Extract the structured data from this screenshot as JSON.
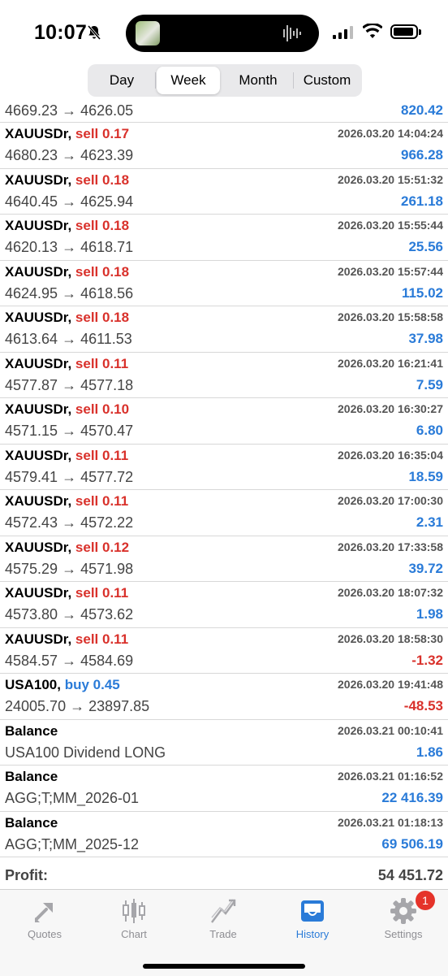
{
  "status_bar": {
    "time": "10:07"
  },
  "period_tabs": [
    {
      "label": "Day",
      "active": false
    },
    {
      "label": "Week",
      "active": true
    },
    {
      "label": "Month",
      "active": false
    },
    {
      "label": "Custom",
      "active": false
    }
  ],
  "partial_row": {
    "detail": "4669.23 → 4626.05",
    "amount": "820.42"
  },
  "deals": [
    {
      "symbol": "XAUUSDr,",
      "side": "sell 0.17",
      "timestamp": "2026.03.20 14:04:24",
      "detail": "4680.23 → 4623.39",
      "amount": "966.28"
    },
    {
      "symbol": "XAUUSDr,",
      "side": "sell 0.18",
      "timestamp": "2026.03.20 15:51:32",
      "detail": "4640.45 → 4625.94",
      "amount": "261.18"
    },
    {
      "symbol": "XAUUSDr,",
      "side": "sell 0.18",
      "timestamp": "2026.03.20 15:55:44",
      "detail": "4620.13 → 4618.71",
      "amount": "25.56"
    },
    {
      "symbol": "XAUUSDr,",
      "side": "sell 0.18",
      "timestamp": "2026.03.20 15:57:44",
      "detail": "4624.95 → 4618.56",
      "amount": "115.02"
    },
    {
      "symbol": "XAUUSDr,",
      "side": "sell 0.18",
      "timestamp": "2026.03.20 15:58:58",
      "detail": "4613.64 → 4611.53",
      "amount": "37.98"
    },
    {
      "symbol": "XAUUSDr,",
      "side": "sell 0.11",
      "timestamp": "2026.03.20 16:21:41",
      "detail": "4577.87 → 4577.18",
      "amount": "7.59"
    },
    {
      "symbol": "XAUUSDr,",
      "side": "sell 0.10",
      "timestamp": "2026.03.20 16:30:27",
      "detail": "4571.15 → 4570.47",
      "amount": "6.80"
    },
    {
      "symbol": "XAUUSDr,",
      "side": "sell 0.11",
      "timestamp": "2026.03.20 16:35:04",
      "detail": "4579.41 → 4577.72",
      "amount": "18.59"
    },
    {
      "symbol": "XAUUSDr,",
      "side": "sell 0.11",
      "timestamp": "2026.03.20 17:00:30",
      "detail": "4572.43 → 4572.22",
      "amount": "2.31"
    },
    {
      "symbol": "XAUUSDr,",
      "side": "sell 0.12",
      "timestamp": "2026.03.20 17:33:58",
      "detail": "4575.29 → 4571.98",
      "amount": "39.72"
    },
    {
      "symbol": "XAUUSDr,",
      "side": "sell 0.11",
      "timestamp": "2026.03.20 18:07:32",
      "detail": "4573.80 → 4573.62",
      "amount": "1.98"
    },
    {
      "symbol": "XAUUSDr,",
      "side": "sell 0.11",
      "timestamp": "2026.03.20 18:58:30",
      "detail": "4584.57 → 4584.69",
      "amount": "-1.32"
    },
    {
      "symbol": "USA100,",
      "side": "buy 0.45",
      "timestamp": "2026.03.20 19:41:48",
      "detail": "24005.70 → 23897.85",
      "amount": "-48.53"
    },
    {
      "symbol": "Balance",
      "side": "",
      "timestamp": "2026.03.21 00:10:41",
      "detail": "USA100 Dividend LONG",
      "amount": "1.86"
    },
    {
      "symbol": "Balance",
      "side": "",
      "timestamp": "2026.03.21 01:16:52",
      "detail": "AGG;T;MM_2026-01",
      "amount": "22 416.39"
    },
    {
      "symbol": "Balance",
      "side": "",
      "timestamp": "2026.03.21 01:18:13",
      "detail": "AGG;T;MM_2025-12",
      "amount": "69 506.19"
    }
  ],
  "summary": {
    "profit_label": "Profit:",
    "profit_value": "54 451.72"
  },
  "tab_bar": [
    {
      "label": "Quotes",
      "icon": "quotes-arrows-icon",
      "active": false
    },
    {
      "label": "Chart",
      "icon": "candlestick-chart-icon",
      "active": false
    },
    {
      "label": "Trade",
      "icon": "trade-line-icon",
      "active": false
    },
    {
      "label": "History",
      "icon": "inbox-tray-icon",
      "active": true
    },
    {
      "label": "Settings",
      "icon": "gear-icon",
      "active": false,
      "badge": "1"
    }
  ],
  "colors": {
    "sell": "#d9312b",
    "buy": "#2a7bd8",
    "positive": "#2a7bd8",
    "negative": "#d9312b",
    "active_tab": "#2a7bd8"
  }
}
